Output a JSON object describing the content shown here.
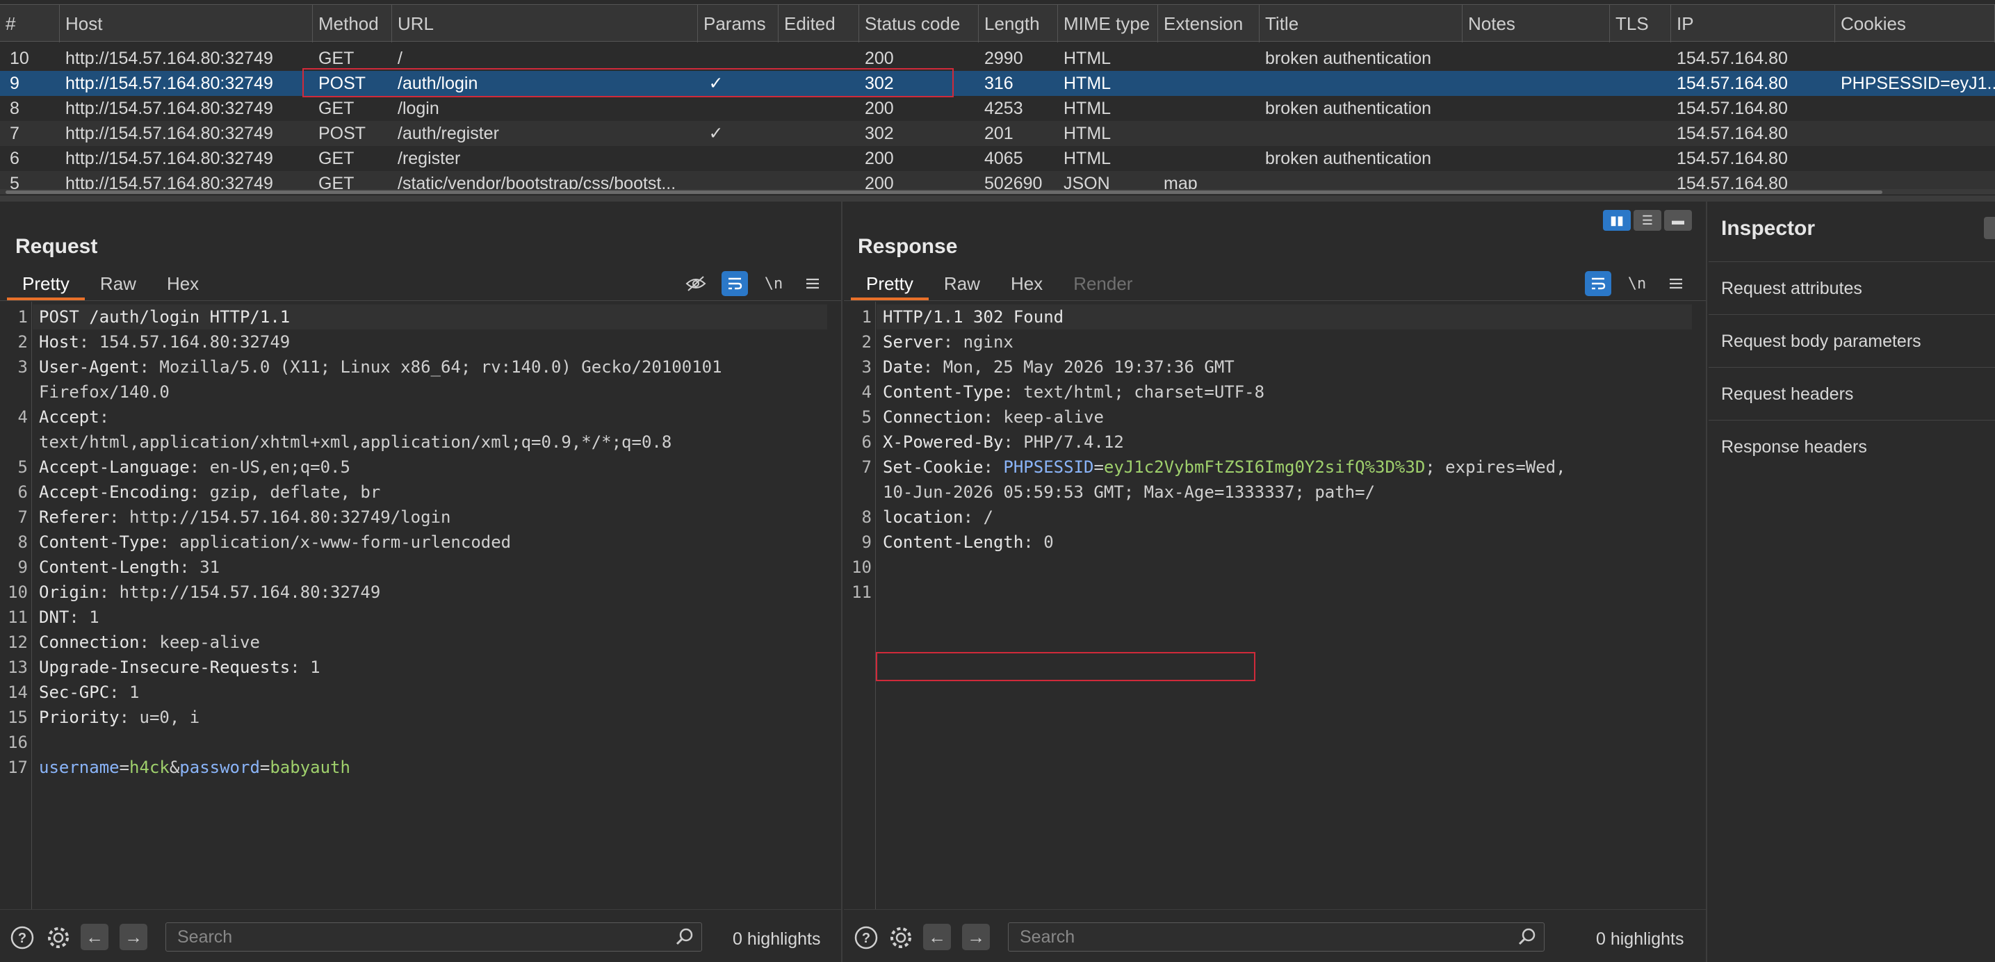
{
  "history": {
    "columns": [
      "#",
      "Host",
      "Method",
      "URL",
      "Params",
      "Edited",
      "Status code",
      "Length",
      "MIME type",
      "Extension",
      "Title",
      "Notes",
      "TLS",
      "IP",
      "Cookies"
    ],
    "rows": [
      {
        "num": "10",
        "host": "http://154.57.164.80:32749",
        "method": "GET",
        "url": "/",
        "params": "",
        "status": "200",
        "length": "2990",
        "mime": "HTML",
        "ext": "",
        "title": "broken authentication",
        "ip": "154.57.164.80",
        "cookies": ""
      },
      {
        "num": "9",
        "host": "http://154.57.164.80:32749",
        "method": "POST",
        "url": "/auth/login",
        "params": "✓",
        "status": "302",
        "length": "316",
        "mime": "HTML",
        "ext": "",
        "title": "",
        "ip": "154.57.164.80",
        "cookies": "PHPSESSID=eyJ1..."
      },
      {
        "num": "8",
        "host": "http://154.57.164.80:32749",
        "method": "GET",
        "url": "/login",
        "params": "",
        "status": "200",
        "length": "4253",
        "mime": "HTML",
        "ext": "",
        "title": "broken authentication",
        "ip": "154.57.164.80",
        "cookies": ""
      },
      {
        "num": "7",
        "host": "http://154.57.164.80:32749",
        "method": "POST",
        "url": "/auth/register",
        "params": "✓",
        "status": "302",
        "length": "201",
        "mime": "HTML",
        "ext": "",
        "title": "",
        "ip": "154.57.164.80",
        "cookies": ""
      },
      {
        "num": "6",
        "host": "http://154.57.164.80:32749",
        "method": "GET",
        "url": "/register",
        "params": "",
        "status": "200",
        "length": "4065",
        "mime": "HTML",
        "ext": "",
        "title": "broken authentication",
        "ip": "154.57.164.80",
        "cookies": ""
      },
      {
        "num": "5",
        "host": "http://154.57.164.80:32749",
        "method": "GET",
        "url": "/static/vendor/bootstrap/css/bootst...",
        "params": "",
        "status": "200",
        "length": "502690",
        "mime": "JSON",
        "ext": "map",
        "title": "",
        "ip": "154.57.164.80",
        "cookies": ""
      }
    ]
  },
  "request": {
    "title": "Request",
    "tabs": [
      "Pretty",
      "Raw",
      "Hex"
    ],
    "lines": [
      {
        "n": "1",
        "parts": [
          [
            "hn",
            "POST /auth/login HTTP/1.1"
          ]
        ]
      },
      {
        "n": "2",
        "parts": [
          [
            "hn",
            "Host"
          ],
          [
            "hv",
            ": 154.57.164.80:32749"
          ]
        ]
      },
      {
        "n": "3",
        "parts": [
          [
            "hn",
            "User-Agent"
          ],
          [
            "hv",
            ": Mozilla/5.0 (X11; Linux x86_64; rv:140.0) Gecko/20100101"
          ]
        ]
      },
      {
        "n": "",
        "parts": [
          [
            "hv",
            "Firefox/140.0"
          ]
        ]
      },
      {
        "n": "4",
        "parts": [
          [
            "hn",
            "Accept"
          ],
          [
            "hv",
            ":"
          ]
        ]
      },
      {
        "n": "",
        "parts": [
          [
            "hv",
            "text/html,application/xhtml+xml,application/xml;q=0.9,*/*;q=0.8"
          ]
        ]
      },
      {
        "n": "5",
        "parts": [
          [
            "hn",
            "Accept-Language"
          ],
          [
            "hv",
            ": en-US,en;q=0.5"
          ]
        ]
      },
      {
        "n": "6",
        "parts": [
          [
            "hn",
            "Accept-Encoding"
          ],
          [
            "hv",
            ": gzip, deflate, br"
          ]
        ]
      },
      {
        "n": "7",
        "parts": [
          [
            "hn",
            "Referer"
          ],
          [
            "hv",
            ": http://154.57.164.80:32749/login"
          ]
        ]
      },
      {
        "n": "8",
        "parts": [
          [
            "hn",
            "Content-Type"
          ],
          [
            "hv",
            ": application/x-www-form-urlencoded"
          ]
        ]
      },
      {
        "n": "9",
        "parts": [
          [
            "hn",
            "Content-Length"
          ],
          [
            "hv",
            ": 31"
          ]
        ]
      },
      {
        "n": "10",
        "parts": [
          [
            "hn",
            "Origin"
          ],
          [
            "hv",
            ": http://154.57.164.80:32749"
          ]
        ]
      },
      {
        "n": "11",
        "parts": [
          [
            "hn",
            "DNT"
          ],
          [
            "hv",
            ": 1"
          ]
        ]
      },
      {
        "n": "12",
        "parts": [
          [
            "hn",
            "Connection"
          ],
          [
            "hv",
            ": keep-alive"
          ]
        ]
      },
      {
        "n": "13",
        "parts": [
          [
            "hn",
            "Upgrade-Insecure-Requests"
          ],
          [
            "hv",
            ": 1"
          ]
        ]
      },
      {
        "n": "14",
        "parts": [
          [
            "hn",
            "Sec-GPC"
          ],
          [
            "hv",
            ": 1"
          ]
        ]
      },
      {
        "n": "15",
        "parts": [
          [
            "hn",
            "Priority"
          ],
          [
            "hv",
            ": u=0, i"
          ]
        ]
      },
      {
        "n": "16",
        "parts": []
      },
      {
        "n": "17",
        "parts": [
          [
            "kb",
            "username"
          ],
          [
            "hv",
            "="
          ],
          [
            "kg",
            "h4ck"
          ],
          [
            "hv",
            "&"
          ],
          [
            "kb",
            "password"
          ],
          [
            "hv",
            "="
          ],
          [
            "kg",
            "babyauth"
          ]
        ]
      }
    ],
    "search_placeholder": "Search",
    "highlights": "0 highlights"
  },
  "response": {
    "title": "Response",
    "tabs": [
      "Pretty",
      "Raw",
      "Hex",
      "Render"
    ],
    "lines": [
      {
        "n": "1",
        "parts": [
          [
            "hn",
            "HTTP/1.1 302 Found"
          ]
        ]
      },
      {
        "n": "2",
        "parts": [
          [
            "hn",
            "Server"
          ],
          [
            "hv",
            ": nginx"
          ]
        ]
      },
      {
        "n": "3",
        "parts": [
          [
            "hn",
            "Date"
          ],
          [
            "hv",
            ": Mon, 25 May 2026 19:37:36 GMT"
          ]
        ]
      },
      {
        "n": "4",
        "parts": [
          [
            "hn",
            "Content-Type"
          ],
          [
            "hv",
            ": text/html; charset=UTF-8"
          ]
        ]
      },
      {
        "n": "5",
        "parts": [
          [
            "hn",
            "Connection"
          ],
          [
            "hv",
            ": keep-alive"
          ]
        ]
      },
      {
        "n": "6",
        "parts": [
          [
            "hn",
            "X-Powered-By"
          ],
          [
            "hv",
            ": PHP/7.4.12"
          ]
        ]
      },
      {
        "n": "7",
        "parts": [
          [
            "hn",
            "Set-Cookie"
          ],
          [
            "hv",
            ": "
          ],
          [
            "kb",
            "PHPSESSID"
          ],
          [
            "hv",
            "="
          ],
          [
            "kg",
            "eyJ1c2VybmFtZSI6Img0Y2sifQ%3D%3D"
          ],
          [
            "hv",
            "; expires=Wed,"
          ]
        ]
      },
      {
        "n": "",
        "parts": [
          [
            "hv",
            "10-Jun-2026 05:59:53 GMT; Max-Age=1333337; path=/"
          ]
        ]
      },
      {
        "n": "8",
        "parts": [
          [
            "hn",
            "location"
          ],
          [
            "hv",
            ": /"
          ]
        ]
      },
      {
        "n": "9",
        "parts": [
          [
            "hn",
            "Content-Length"
          ],
          [
            "hv",
            ": 0"
          ]
        ]
      },
      {
        "n": "10",
        "parts": []
      },
      {
        "n": "11",
        "parts": []
      }
    ],
    "search_placeholder": "Search",
    "highlights": "0 highlights"
  },
  "inspector": {
    "title": "Inspector",
    "items": [
      "Request attributes",
      "Request body parameters",
      "Request headers",
      "Response headers"
    ]
  },
  "icons": {
    "help": "help-icon",
    "settings": "gear-icon",
    "back": "arrow-left-icon",
    "forward": "arrow-right-icon",
    "search": "search-icon"
  },
  "colors": {
    "selected_row": "#1f4e7a",
    "accent": "#e8702a",
    "highlight_box": "#d02a3a",
    "toggle_on": "#2b78c8"
  }
}
